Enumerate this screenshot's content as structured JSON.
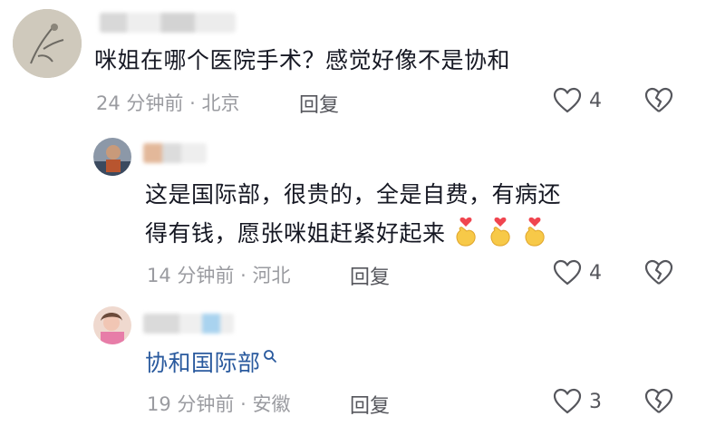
{
  "comments": [
    {
      "text": "咪姐在哪个医院手术？感觉好像不是协和",
      "time": "24 分钟前",
      "location": "北京",
      "reply_label": "回复",
      "likes": "4"
    },
    {
      "text_line1": "这是国际部，很贵的，全是自费，有病还",
      "text_line2": "得有钱，愿张咪姐赶紧好起来",
      "time": "14 分钟前",
      "location": "河北",
      "reply_label": "回复",
      "likes": "4"
    },
    {
      "link_text": "协和国际部",
      "time": "19 分钟前",
      "location": "安徽",
      "reply_label": "回复",
      "likes": "3"
    }
  ],
  "separator": "·",
  "icons": {
    "like": "heart-outline-icon",
    "dislike": "broken-heart-icon",
    "search": "search-icon",
    "emoji": "finger-heart-emoji"
  },
  "colors": {
    "text": "#161823",
    "meta": "#9a9ba0",
    "link": "#2a5a9e",
    "icon": "#55565c"
  }
}
